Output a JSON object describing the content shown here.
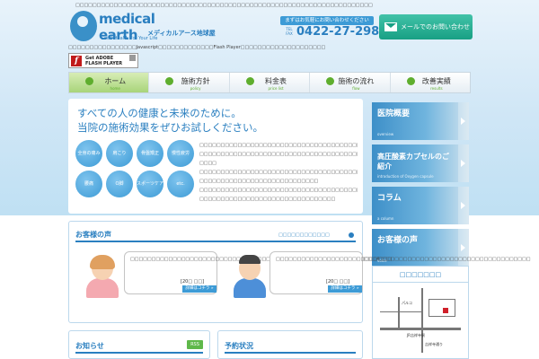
{
  "header": {
    "tagline": "□□□□□□□□□□□□□□□□□□□□□□□□□□□□□□□□□□□□□□□□□□□□□□□□□□□□□□□□□□□□□□□□□□□□□□",
    "logo_text": "medical earth",
    "logo_kana": "メディカルアース地球屋",
    "logo_sub": "Good Health For Your Life",
    "flash_note": "□□□□□□□□□□□□□□□□Javascript□□□□□□□□□□□□□Flash Player□□□□□□□□□□□□□□□□□□□□",
    "flash_badge": {
      "line1": "Get ADOBE",
      "line2": "FLASH PLAYER",
      "glyph": "f"
    },
    "contact_label": "まずはお気軽にお問い合わせください",
    "tel_label": "TEL FAX",
    "tel": "0422-27-2983",
    "mail_button": "メールでのお問い合わせ"
  },
  "nav": [
    {
      "label": "ホーム",
      "sub": "home",
      "active": true
    },
    {
      "label": "施術方針",
      "sub": "policy",
      "active": false
    },
    {
      "label": "料金表",
      "sub": "price list",
      "active": false
    },
    {
      "label": "施術の流れ",
      "sub": "flow",
      "active": false
    },
    {
      "label": "改善実績",
      "sub": "results",
      "active": false
    }
  ],
  "main": {
    "headline_1": "すべての人の健康と未来のために。",
    "headline_2": "当院の施術効果をぜひお試しください。",
    "circles": [
      "全身の痛み",
      "肩こり",
      "骨盤矯正",
      "慢性疲労",
      "腰痛",
      "O脚",
      "スポーツケア",
      "etc."
    ],
    "desc": [
      "□□□□□□□□□□□□□□□□□□□□□□□□□□□□□□□□□□□□□□□□□□",
      "□□□□□□□□□□□□□□□□□□□□□□□□□□□□□□□□□□□□□□□□□□",
      "□□□□",
      "□□□□□□□□□□□□□□□□□□□□□□□□□□□□□□□□□□□□□□□□□□",
      "□□□□□□□□□□□□□□□□□□□□□□□□□□□□",
      "□□□□□□□□□□□□□□□□□□□□□□□□□□□□□□□□□□□□□□□□□□",
      "□□□□□□□□□□□□□□□□□□□□□□□□□□□□□□□□"
    ]
  },
  "sidebar": [
    {
      "label": "医院概要",
      "sub": "overview"
    },
    {
      "label": "高圧酸素カプセルのご紹介",
      "sub": "introduction of Oxygen capsule"
    },
    {
      "label": "コラム",
      "sub": "a column"
    },
    {
      "label": "お客様の声",
      "sub": "voice"
    }
  ],
  "voices": {
    "title": "お客様の声",
    "more": "□□□□□□□□□□□□",
    "items": [
      {
        "text": "□□□□□□□□□□□□□□□□□□□□□□□□□□□□□□□□□□□□□□□□□□□□□□□□□□□□□□□□□□4□□□",
        "age": "[20□ □□]",
        "button": "詳細はコチラ »"
      },
      {
        "text": "□□□□□□□□□□□□□□□□□□□□□□□□□□□□□□□□□□□□□□□□□□□□□□□□□□□□□□□□□□□□",
        "age": "[20□ □□]",
        "button": "詳細はコチラ »"
      }
    ]
  },
  "news": {
    "title": "お知らせ",
    "rss": "RSS"
  },
  "reservation": {
    "title": "予約状況"
  },
  "access": {
    "title": "□□□□□□□",
    "map_labels": [
      "パルコ",
      "JR吉祥寺駅",
      "吉祥寺通り"
    ]
  },
  "colors": {
    "brand": "#2a7fc0",
    "accent_green": "#5fae2e",
    "mail_green": "#18a084"
  }
}
